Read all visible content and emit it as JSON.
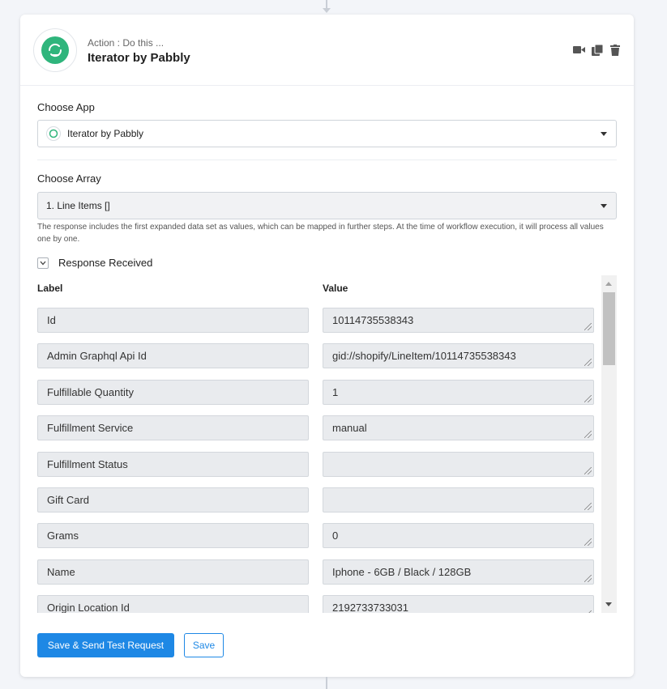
{
  "header": {
    "subtitle": "Action : Do this ...",
    "title": "Iterator by Pabbly",
    "icons": [
      "video-icon",
      "copy-icon",
      "trash-icon"
    ]
  },
  "choose_app": {
    "label": "Choose App",
    "selected": "Iterator by Pabbly"
  },
  "choose_array": {
    "label": "Choose Array",
    "selected": "1. Line Items []",
    "helper": "The response includes the first expanded data set as values, which can be mapped in further steps. At the time of workflow execution, it will process all values one by one."
  },
  "response": {
    "toggle_label": "Response Received",
    "col_label": "Label",
    "col_value": "Value",
    "rows": [
      {
        "label": "Id",
        "value": "10114735538343"
      },
      {
        "label": "Admin Graphql Api Id",
        "value": "gid://shopify/LineItem/10114735538343"
      },
      {
        "label": "Fulfillable Quantity",
        "value": "1"
      },
      {
        "label": "Fulfillment Service",
        "value": "manual"
      },
      {
        "label": "Fulfillment Status",
        "value": ""
      },
      {
        "label": "Gift Card",
        "value": ""
      },
      {
        "label": "Grams",
        "value": "0"
      },
      {
        "label": "Name",
        "value": "Iphone - 6GB / Black / 128GB"
      },
      {
        "label": "Origin Location Id",
        "value": "2192733733031"
      }
    ]
  },
  "buttons": {
    "primary": "Save & Send Test Request",
    "secondary": "Save"
  },
  "colors": {
    "brand_green": "#2fb57c",
    "primary_blue": "#1e88e5"
  }
}
